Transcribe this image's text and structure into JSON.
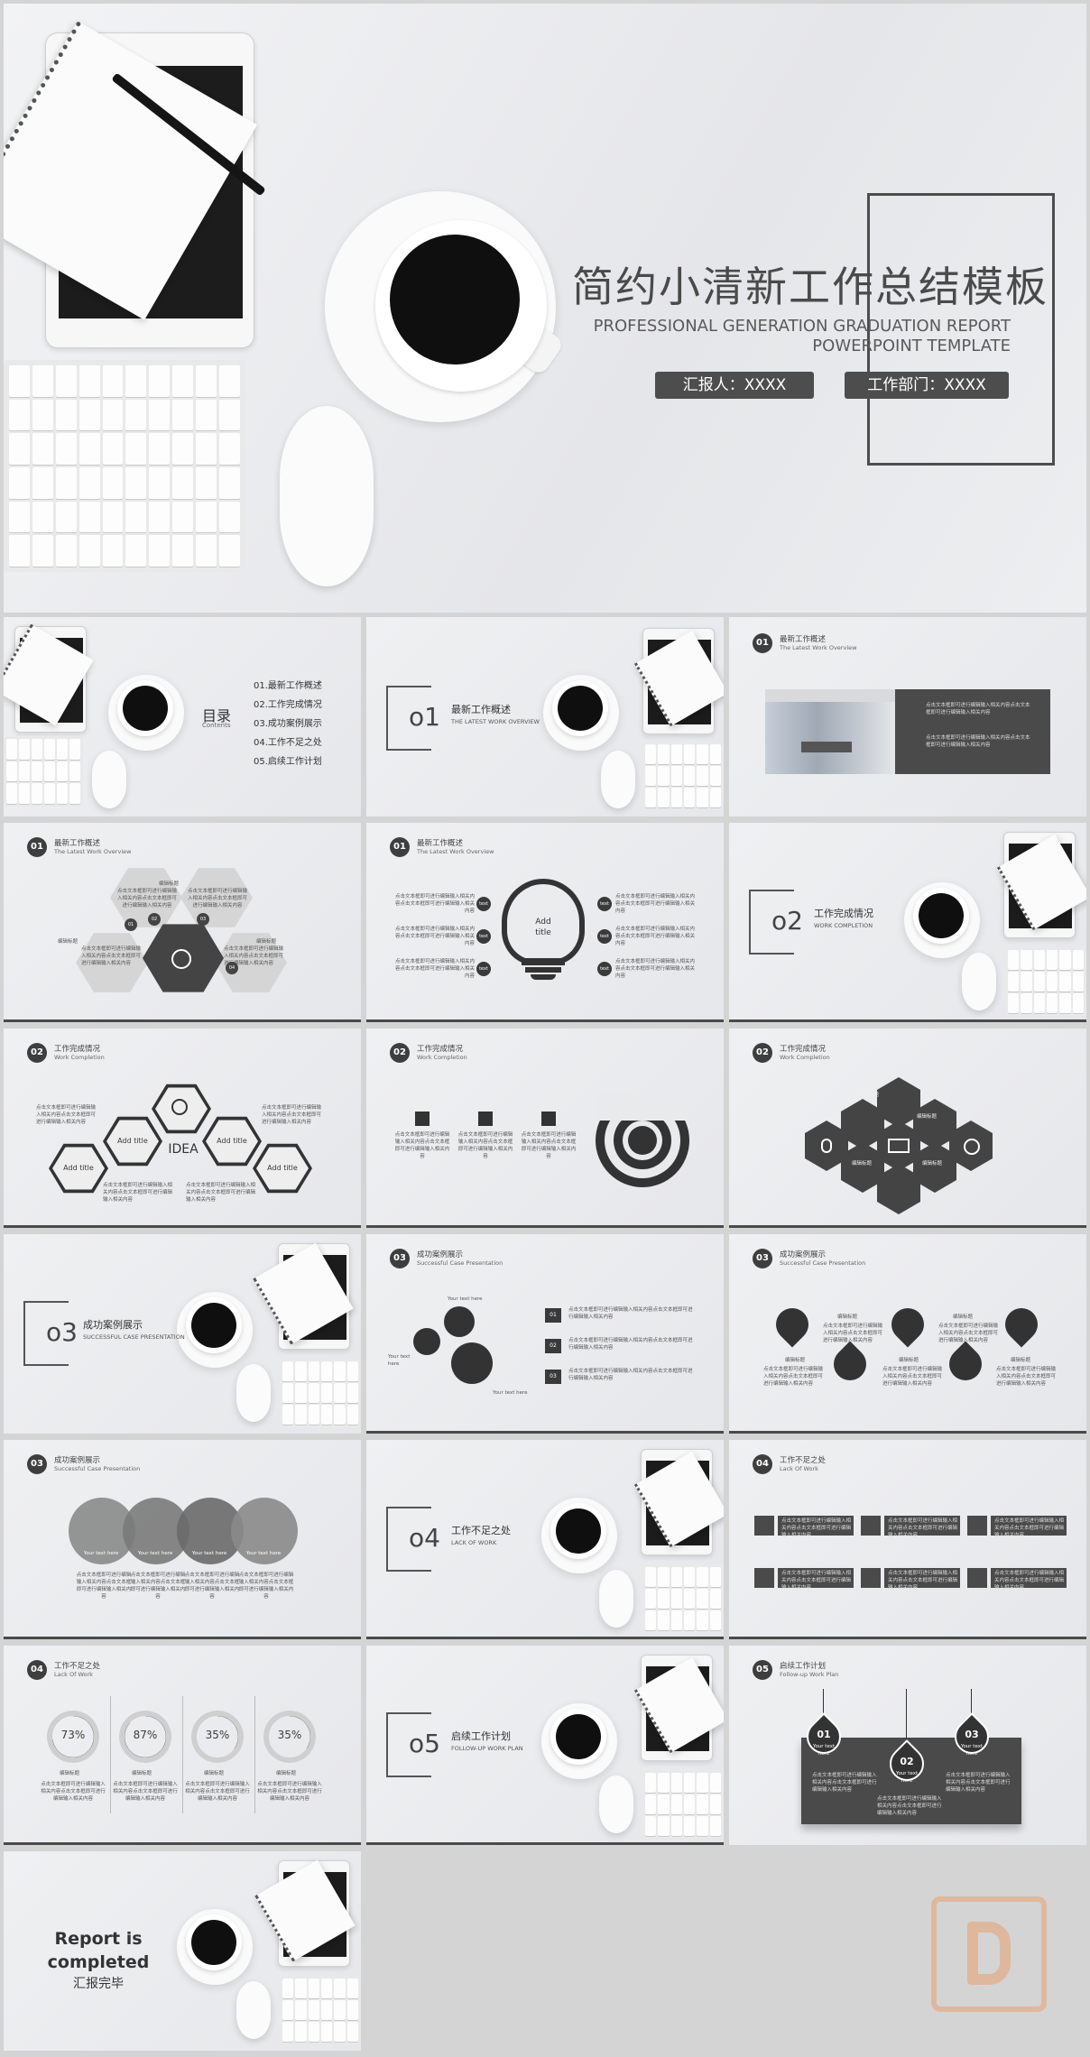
{
  "hero": {
    "title": "简约小清新工作总结模板",
    "subtitle_line1": "PROFESSIONAL GENERATION GRADUATION REPORT",
    "subtitle_line2": "POWERPOINT TEMPLATE",
    "reporter": "汇报人：XXXX",
    "department": "工作部门：XXXX"
  },
  "contents": {
    "title": "目录",
    "subtitle": "Contents",
    "items": [
      "01.最新工作概述",
      "02.工作完成情况",
      "03.成功案例展示",
      "04.工作不足之处",
      "05.启续工作计划"
    ]
  },
  "sections": [
    {
      "num": "o1",
      "title": "最新工作概述",
      "sub": "THE LATEST WORK OVERVIEW"
    },
    {
      "num": "o2",
      "title": "工作完成情况",
      "sub": "WORK COMPLETION"
    },
    {
      "num": "o3",
      "title": "成功案例展示",
      "sub": "SUCCESSFUL CASE PRESENTATION"
    },
    {
      "num": "o4",
      "title": "工作不足之处",
      "sub": "LACK OF WORK"
    },
    {
      "num": "o5",
      "title": "启续工作计划",
      "sub": "FOLLOW-UP WORK PLAN"
    }
  ],
  "headers": {
    "h1": {
      "num": "01",
      "cn": "最新工作概述",
      "en": "The Latest Work Overview"
    },
    "h2": {
      "num": "02",
      "cn": "工作完成情况",
      "en": "Work Completion"
    },
    "h3": {
      "num": "03",
      "cn": "成功案例展示",
      "en": "Successful Case Presentation"
    },
    "h4": {
      "num": "04",
      "cn": "工作不足之处",
      "en": "Lack Of Work"
    },
    "h5": {
      "num": "05",
      "cn": "启续工作计划",
      "en": "Follow-up  Work Plan"
    }
  },
  "common": {
    "heading": "编辑标题",
    "body": "点击文本框即可进行编辑输入相关内容点击文本框即可进行编辑输入相关内容",
    "text": "text",
    "add_title": "Add title",
    "add_title_2": "Add\ntitle",
    "idea": "IDEA",
    "your_text": "Your text here",
    "your_text_short": "Your text",
    "your_text_here2": "Your text here"
  },
  "numbers": [
    "01",
    "02",
    "03",
    "04"
  ],
  "progress": [
    {
      "label": "73%",
      "value": 73
    },
    {
      "label": "87%",
      "value": 87
    },
    {
      "label": "35%",
      "value": 35
    },
    {
      "label": "35%",
      "value": 35
    }
  ],
  "plan_drops": [
    "01",
    "02",
    "03"
  ],
  "ending": {
    "line1": "Report is",
    "line2": "completed",
    "line3": "汇报完毕"
  },
  "colors": {
    "dark": "#444444",
    "light": "#d5d5d5",
    "bg": "#d4d4d5",
    "watermark": "#e2b08e"
  }
}
